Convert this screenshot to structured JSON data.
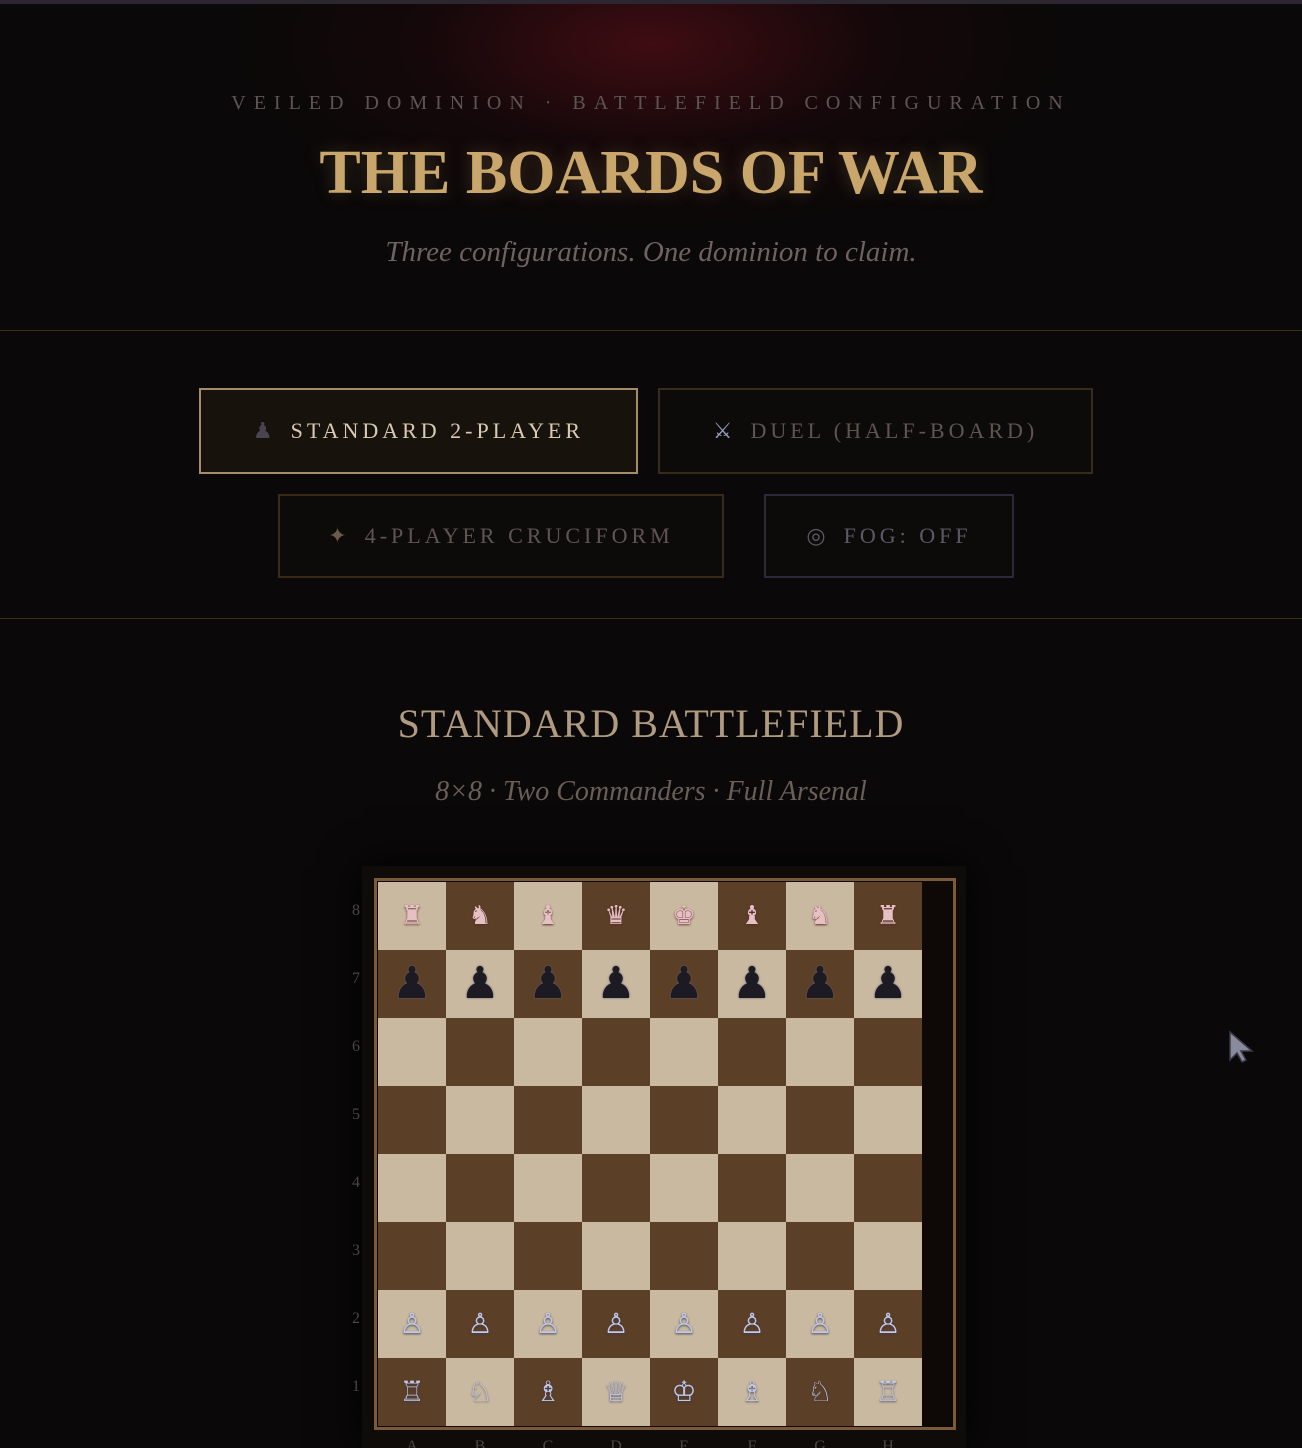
{
  "header": {
    "kicker": "VEILED DOMINION · BATTLEFIELD CONFIGURATION",
    "title": "THE BOARDS OF WAR",
    "tagline": "Three configurations. One dominion to claim."
  },
  "modes": [
    {
      "label": "STANDARD 2-PLAYER",
      "icon": "♟",
      "icon_name": "pawn-icon",
      "active": true
    },
    {
      "label": "DUEL (HALF-BOARD)",
      "icon": "⚔",
      "icon_name": "crossed-swords-icon",
      "active": false
    },
    {
      "label": "4-PLAYER CRUCIFORM",
      "icon": "✦",
      "icon_name": "four-point-star-icon",
      "active": false
    }
  ],
  "fog": {
    "label": "FOG: OFF",
    "icon": "◎",
    "icon_name": "fog-ring-icon"
  },
  "section": {
    "title": "STANDARD BATTLEFIELD",
    "subtitle": "8×8 · Two Commanders · Full Arsenal"
  },
  "board": {
    "ranks": [
      "8",
      "7",
      "6",
      "5",
      "4",
      "3",
      "2",
      "1"
    ],
    "files": [
      "A",
      "B",
      "C",
      "D",
      "E",
      "F",
      "G",
      "H"
    ],
    "position": [
      [
        "crimson:♜",
        "crimson:♞",
        "crimson:♝",
        "crimson:♛",
        "crimson:♚",
        "crimson:♝",
        "crimson:♞",
        "crimson:♜"
      ],
      [
        "ebony:♟",
        "ebony:♟",
        "ebony:♟",
        "ebony:♟",
        "ebony:♟",
        "ebony:♟",
        "ebony:♟",
        "ebony:♟"
      ],
      [
        "",
        "",
        "",
        "",
        "",
        "",
        "",
        ""
      ],
      [
        "",
        "",
        "",
        "",
        "",
        "",
        "",
        ""
      ],
      [
        "",
        "",
        "",
        "",
        "",
        "",
        "",
        ""
      ],
      [
        "",
        "",
        "",
        "",
        "",
        "",
        "",
        ""
      ],
      [
        "ivory:♙",
        "ivory:♙",
        "ivory:♙",
        "ivory:♙",
        "ivory:♙",
        "ivory:♙",
        "ivory:♙",
        "ivory:♙"
      ],
      [
        "ivory:♖",
        "ivory:♘",
        "ivory:♗",
        "ivory:♕",
        "ivory:♔",
        "ivory:♗",
        "ivory:♘",
        "ivory:♖"
      ]
    ],
    "colors": {
      "light": "#c9b9a1",
      "dark": "#5b3f27",
      "frame": "#7a5a38"
    }
  },
  "colors": {
    "accent": "#c9a66b",
    "background": "#0a0808"
  }
}
